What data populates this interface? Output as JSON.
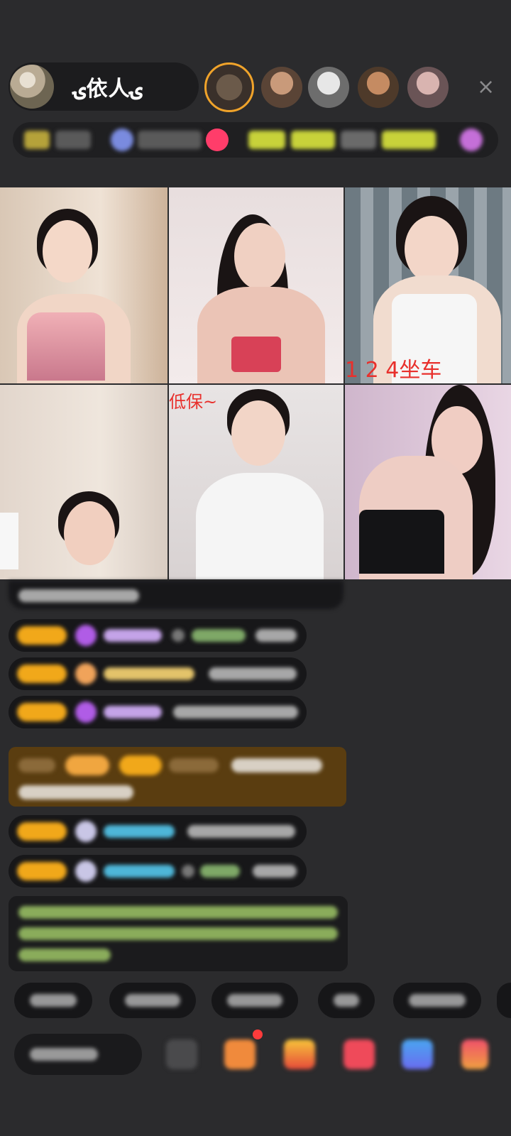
{
  "header": {
    "host_name": "ۍ依人ۍ",
    "close_icon": "×",
    "viewers": [
      "viewer-1",
      "viewer-2",
      "viewer-3",
      "viewer-4",
      "viewer-5"
    ]
  },
  "grid": {
    "overlays": {
      "tile3": "1 2 4坐车",
      "tile5": "低保~"
    }
  },
  "colors": {
    "background": "#2b2b2d",
    "badge": "#f1a81a",
    "notice": "#5a3d10",
    "announcement_text": "#a6d16b",
    "overlay_text": "#e8302c"
  },
  "icons": [
    "close-icon",
    "gem-icon",
    "gift-icon",
    "more-icon"
  ]
}
